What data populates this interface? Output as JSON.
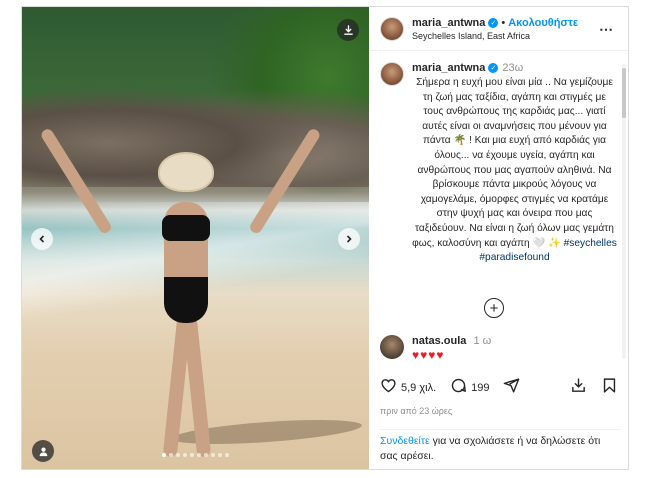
{
  "post": {
    "username": "maria_antwna",
    "follow_label": "Ακολουθήστε",
    "dot_separator": "•",
    "location": "Seychelles Island, East Africa",
    "more_icon": "⋯",
    "caption_time": "23ω",
    "caption_text": "Σήμερα η ευχή μου είναι μία .. Να γεμίζουμε τη ζωή μας ταξίδια, αγάπη και στιγμές με τους ανθρώπους της καρδιάς μας... γιατί αυτές είναι οι αναμνήσεις που μένουν για πάντα 🌴 ! Και μια ευχή από καρδιάς για όλους... να έχουμε υγεία, αγάπη και ανθρώπους που μας αγαπούν αληθινά. Να βρίσκουμε πάντα μικρούς λόγους να χαμογελάμε, όμορφες στιγμές να κρατάμε στην ψυχή μας και όνειρα που μας ταξιδεύουν. Να είναι η ζωή όλων μας γεμάτη φως, καλοσύνη και αγάπη 🤍 ✨ ",
    "hashtags": "#seychelles #paradisefound"
  },
  "comment": {
    "username": "natas.oula",
    "time": "1 ω",
    "text": "♥♥♥♥"
  },
  "actions": {
    "likes": "5,9 χιλ.",
    "comments": "199",
    "time_ago": "πριν από 23 ώρες"
  },
  "login_prompt": {
    "link": "Συνδεθείτε",
    "text": " για να σχολιάσετε ή να δηλώσετε ότι σας αρέσει."
  },
  "icons": {
    "download": "download-icon",
    "prev": "chevron-left-icon",
    "next": "chevron-right-icon",
    "user": "user-icon",
    "like": "heart-icon",
    "comment": "comment-icon",
    "share": "share-icon",
    "save": "bookmark-icon",
    "add": "plus-icon"
  },
  "colors": {
    "accent": "#0095f6",
    "hashtag": "#00376b",
    "heart": "#ed1c24"
  }
}
